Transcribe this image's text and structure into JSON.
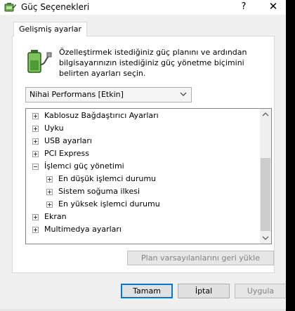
{
  "window": {
    "title": "Güç Seçenekleri",
    "help_label": "?",
    "close_label": "✕"
  },
  "tab": {
    "label": "Gelişmiş ayarlar"
  },
  "description": "Özelleştirmek istediğiniz güç planını ve ardından bilgisayarınızın istediğiniz güç yönetme biçimini belirten ayarları seçin.",
  "plan_select": {
    "value": "Nihai Performans [Etkin]"
  },
  "tree": {
    "items": [
      {
        "label": "Kablosuz Bağdaştırıcı Ayarları",
        "state": "collapsed"
      },
      {
        "label": "Uyku",
        "state": "collapsed"
      },
      {
        "label": "USB ayarları",
        "state": "collapsed"
      },
      {
        "label": "PCI Express",
        "state": "collapsed"
      },
      {
        "label": "İşlemci güç yönetimi",
        "state": "expanded"
      },
      {
        "label": "En düşük işlemci durumu",
        "state": "collapsed"
      },
      {
        "label": "Sistem soğuma ilkesi",
        "state": "collapsed"
      },
      {
        "label": "En yüksek işlemci durumu",
        "state": "collapsed"
      },
      {
        "label": "Ekran",
        "state": "collapsed"
      },
      {
        "label": "Multimedya ayarları",
        "state": "collapsed"
      }
    ]
  },
  "buttons": {
    "restore": "Plan varsayılanlarını geri yükle",
    "ok": "Tamam",
    "cancel": "İptal",
    "apply": "Uygula"
  },
  "colors": {
    "accent": "#0078d7",
    "dialog_bg": "#f0f0f0",
    "disabled_text": "#838383"
  }
}
